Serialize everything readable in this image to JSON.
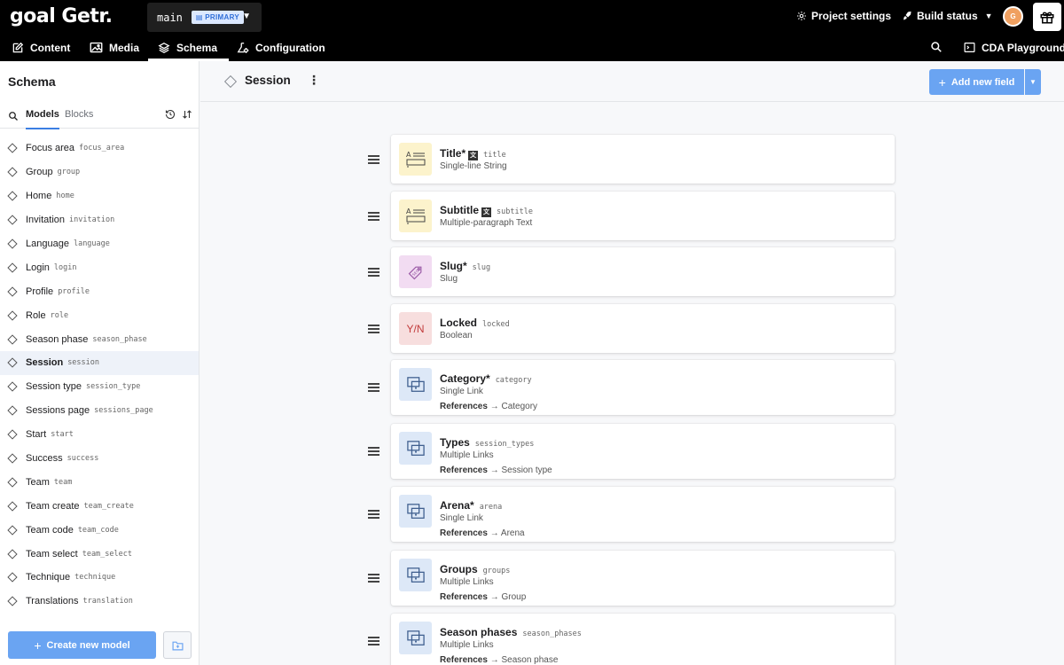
{
  "app": {
    "logo": "goal Getr.",
    "environment": "main",
    "environment_badge": "PRIMARY",
    "project_settings": "Project settings",
    "build_status": "Build status",
    "avatar_initial": "G"
  },
  "nav": {
    "content": "Content",
    "media": "Media",
    "schema": "Schema",
    "configuration": "Configuration",
    "cda": "CDA Playground"
  },
  "sidebar": {
    "title": "Schema",
    "tab_models": "Models",
    "tab_blocks": "Blocks",
    "create_button": "Create new model",
    "items": [
      {
        "label": "Focus area",
        "api": "focus_area"
      },
      {
        "label": "Group",
        "api": "group"
      },
      {
        "label": "Home",
        "api": "home"
      },
      {
        "label": "Invitation",
        "api": "invitation"
      },
      {
        "label": "Language",
        "api": "language"
      },
      {
        "label": "Login",
        "api": "login"
      },
      {
        "label": "Profile",
        "api": "profile"
      },
      {
        "label": "Role",
        "api": "role"
      },
      {
        "label": "Season phase",
        "api": "season_phase"
      },
      {
        "label": "Session",
        "api": "session"
      },
      {
        "label": "Session type",
        "api": "session_type"
      },
      {
        "label": "Sessions page",
        "api": "sessions_page"
      },
      {
        "label": "Start",
        "api": "start"
      },
      {
        "label": "Success",
        "api": "success"
      },
      {
        "label": "Team",
        "api": "team"
      },
      {
        "label": "Team create",
        "api": "team_create"
      },
      {
        "label": "Team code",
        "api": "team_code"
      },
      {
        "label": "Team select",
        "api": "team_select"
      },
      {
        "label": "Technique",
        "api": "technique"
      },
      {
        "label": "Translations",
        "api": "translation"
      }
    ]
  },
  "main": {
    "title": "Session",
    "add_button": "Add new field",
    "references_label": "References",
    "fields": [
      {
        "name": "Title*",
        "api": "title",
        "type": "Single-line String",
        "icon": "string",
        "localized": true
      },
      {
        "name": "Subtitle",
        "api": "subtitle",
        "type": "Multiple-paragraph Text",
        "icon": "string",
        "localized": true
      },
      {
        "name": "Slug*",
        "api": "slug",
        "type": "Slug",
        "icon": "slug"
      },
      {
        "name": "Locked",
        "api": "locked",
        "type": "Boolean",
        "icon": "boolean",
        "icon_text": "Y/N"
      },
      {
        "name": "Category*",
        "api": "category",
        "type": "Single Link",
        "icon": "link",
        "ref": "→ Category"
      },
      {
        "name": "Types",
        "api": "session_types",
        "type": "Multiple Links",
        "icon": "link",
        "ref": "→ Session type"
      },
      {
        "name": "Arena*",
        "api": "arena",
        "type": "Single Link",
        "icon": "link",
        "ref": "→ Arena"
      },
      {
        "name": "Groups",
        "api": "groups",
        "type": "Multiple Links",
        "icon": "link",
        "ref": "→ Group"
      },
      {
        "name": "Season phases",
        "api": "season_phases",
        "type": "Multiple Links",
        "icon": "link",
        "ref": "→ Season phase"
      }
    ]
  }
}
